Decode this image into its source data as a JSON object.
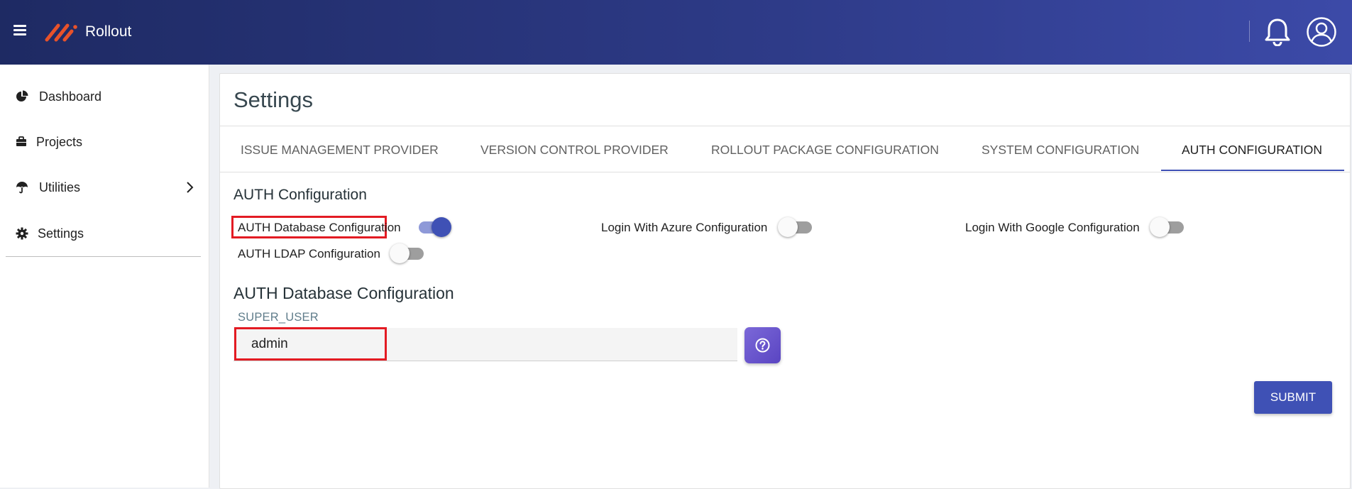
{
  "header": {
    "app_name": "Rollout",
    "brand_color": "#e8522a",
    "icons": [
      "menu-icon",
      "logo-icon",
      "bell-icon",
      "user-avatar-icon"
    ]
  },
  "sidebar": {
    "items": [
      {
        "label": "Dashboard",
        "icon": "pie-chart-icon"
      },
      {
        "label": "Projects",
        "icon": "briefcase-icon"
      },
      {
        "label": "Utilities",
        "icon": "umbrella-icon",
        "has_submenu": true
      },
      {
        "label": "Settings",
        "icon": "gear-icon"
      }
    ]
  },
  "page": {
    "title": "Settings",
    "tabs": [
      {
        "label": "ISSUE MANAGEMENT PROVIDER"
      },
      {
        "label": "VERSION CONTROL PROVIDER"
      },
      {
        "label": "ROLLOUT PACKAGE CONFIGURATION"
      },
      {
        "label": "SYSTEM CONFIGURATION"
      },
      {
        "label": "AUTH CONFIGURATION",
        "active": true
      }
    ],
    "section_title": "AUTH Configuration",
    "switches": [
      {
        "label": "AUTH Database Configuration",
        "on": true
      },
      {
        "label": "Login With Azure Configuration",
        "on": false
      },
      {
        "label": "Login With Google Configuration",
        "on": false
      },
      {
        "label": "AUTH LDAP Configuration",
        "on": false
      }
    ],
    "subsection_title": "AUTH Database Configuration",
    "field": {
      "label": "SUPER_USER",
      "value": "admin"
    },
    "submit_label": "SUBMIT",
    "accent_color": "#3f51b5",
    "highlight_color": "#e31b23"
  }
}
